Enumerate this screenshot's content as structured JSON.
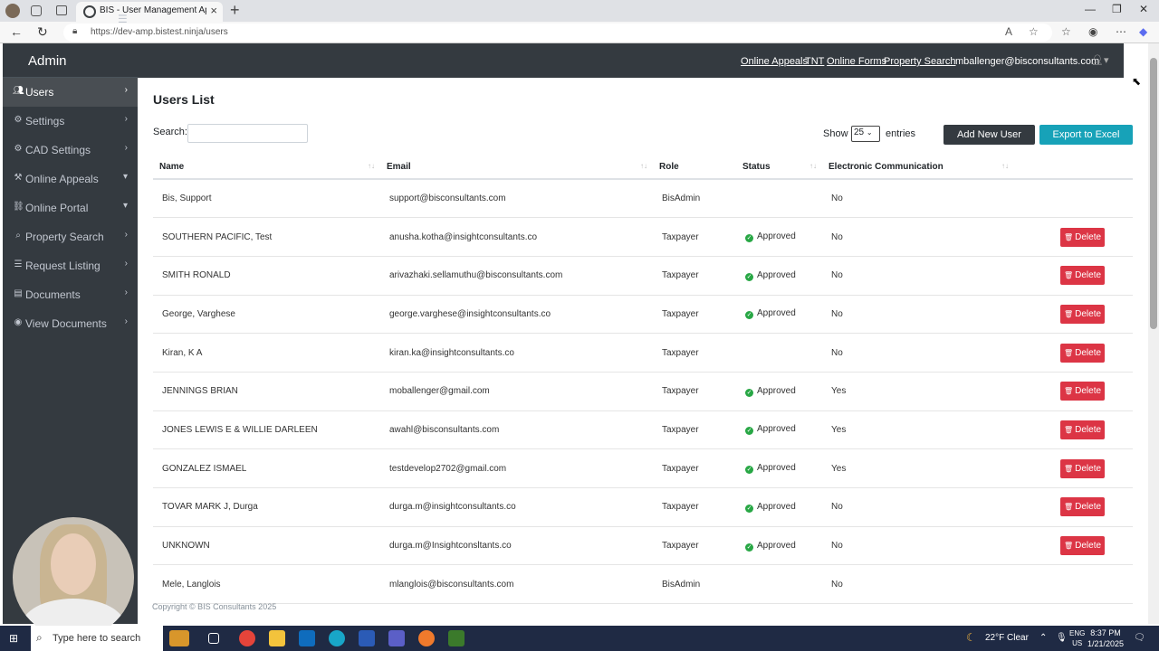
{
  "browser": {
    "tab_title": "BIS - User Management Applicatio",
    "url": "https://dev-amp.bistest.ninja/users"
  },
  "sidebar": {
    "brand": "Admin",
    "items": [
      {
        "label": "Users",
        "icon": "users-icon",
        "arrow": "›"
      },
      {
        "label": "Settings",
        "icon": "gear-icon",
        "arrow": "›"
      },
      {
        "label": "CAD Settings",
        "icon": "gear-icon",
        "arrow": "›"
      },
      {
        "label": "Online Appeals",
        "icon": "gavel-icon",
        "arrow": "▾"
      },
      {
        "label": "Online Portal",
        "icon": "link-icon",
        "arrow": "▾"
      },
      {
        "label": "Property Search",
        "icon": "search-icon",
        "arrow": "›"
      },
      {
        "label": "Request Listing",
        "icon": "list-icon",
        "arrow": "›"
      },
      {
        "label": "Documents",
        "icon": "file-icon",
        "arrow": "›"
      },
      {
        "label": "View Documents",
        "icon": "eye-icon",
        "arrow": "›"
      }
    ]
  },
  "topnav": {
    "links": [
      "Online Appeals",
      "TNT",
      "Online Forms",
      "Property Search"
    ],
    "user_email": "mballenger@bisconsultants.com"
  },
  "main": {
    "title": "Users List",
    "search_label": "Search:",
    "search_value": "",
    "show_label": "Show",
    "show_value": "25",
    "entries_label": "entries",
    "add_button": "Add New User",
    "export_button": "Export to Excel",
    "columns": [
      "Name",
      "Email",
      "Role",
      "Status",
      "Electronic Communication"
    ],
    "delete_label": "Delete",
    "rows": [
      {
        "name": "Bis, Support",
        "email": "support@bisconsultants.com",
        "role": "BisAdmin",
        "status": "",
        "ecomm": "No",
        "deletable": false
      },
      {
        "name": "SOUTHERN PACIFIC, Test",
        "email": "anusha.kotha@insightconsultants.co",
        "role": "Taxpayer",
        "status": "Approved",
        "ecomm": "No",
        "deletable": true
      },
      {
        "name": "SMITH RONALD",
        "email": "arivazhaki.sellamuthu@bisconsultants.com",
        "role": "Taxpayer",
        "status": "Approved",
        "ecomm": "No",
        "deletable": true
      },
      {
        "name": "George, Varghese",
        "email": "george.varghese@insightconsultants.co",
        "role": "Taxpayer",
        "status": "Approved",
        "ecomm": "No",
        "deletable": true
      },
      {
        "name": "Kiran, K A",
        "email": "kiran.ka@insightconsultants.co",
        "role": "Taxpayer",
        "status": "",
        "ecomm": "No",
        "deletable": true
      },
      {
        "name": "JENNINGS BRIAN",
        "email": "moballenger@gmail.com",
        "role": "Taxpayer",
        "status": "Approved",
        "ecomm": "Yes",
        "deletable": true
      },
      {
        "name": "JONES LEWIS E & WILLIE DARLEEN",
        "email": "awahl@bisconsultants.com",
        "role": "Taxpayer",
        "status": "Approved",
        "ecomm": "Yes",
        "deletable": true
      },
      {
        "name": "GONZALEZ ISMAEL",
        "email": "testdevelop2702@gmail.com",
        "role": "Taxpayer",
        "status": "Approved",
        "ecomm": "Yes",
        "deletable": true
      },
      {
        "name": "TOVAR MARK J, Durga",
        "email": "durga.m@insightconsultants.co",
        "role": "Taxpayer",
        "status": "Approved",
        "ecomm": "No",
        "deletable": true
      },
      {
        "name": "UNKNOWN",
        "email": "durga.m@Insightconsltants.co",
        "role": "Taxpayer",
        "status": "Approved",
        "ecomm": "No",
        "deletable": true
      },
      {
        "name": "Mele, Langlois",
        "email": "mlanglois@bisconsultants.com",
        "role": "BisAdmin",
        "status": "",
        "ecomm": "No",
        "deletable": false
      }
    ]
  },
  "footer": {
    "text": "Copyright © BIS Consultants 2025"
  },
  "taskbar": {
    "search_placeholder": "Type here to search",
    "weather": "22°F  Clear",
    "lang_top": "ENG",
    "lang_bottom": "US",
    "time": "8:37 PM",
    "date": "1/21/2025"
  }
}
